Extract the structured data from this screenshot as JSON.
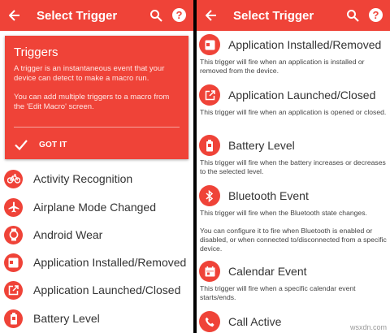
{
  "left": {
    "appbar": {
      "title": "Select Trigger"
    },
    "card": {
      "heading": "Triggers",
      "paragraph1": "A trigger is an instantaneous event that your device can detect to make a macro run.",
      "paragraph2": "You can add multiple triggers to a macro from the 'Edit Macro' screen.",
      "button": "GOT IT"
    },
    "items": [
      {
        "label": "Activity Recognition",
        "icon": "bicycle-icon"
      },
      {
        "label": "Airplane Mode Changed",
        "icon": "airplane-icon"
      },
      {
        "label": "Android Wear",
        "icon": "watch-icon"
      },
      {
        "label": "Application Installed/Removed",
        "icon": "app-install-icon"
      },
      {
        "label": "Application Launched/Closed",
        "icon": "launch-icon"
      },
      {
        "label": "Battery Level",
        "icon": "battery-icon"
      }
    ]
  },
  "right": {
    "appbar": {
      "title": "Select Trigger"
    },
    "items": [
      {
        "label": "Application Installed/Removed",
        "icon": "app-install-icon",
        "desc": [
          "This trigger will fire when an application is installed or removed from the device."
        ]
      },
      {
        "label": "Application Launched/Closed",
        "icon": "launch-icon",
        "desc": [
          "This trigger will fire when an application is opened or closed."
        ]
      },
      {
        "label": "Battery Level",
        "icon": "battery-icon",
        "desc": [
          "This trigger will fire when the battery increases or decreases to the selected level."
        ]
      },
      {
        "label": "Bluetooth Event",
        "icon": "bluetooth-icon",
        "desc": [
          "This trigger will fire when the Bluetooth state changes.",
          "You can configure it to fire when Bluetooth is enabled or disabled, or when connected to/disconnected from a specific device."
        ]
      },
      {
        "label": "Calendar Event",
        "icon": "calendar-icon",
        "desc": [
          "This trigger will fire when a specific calendar event starts/ends."
        ]
      },
      {
        "label": "Call Active",
        "icon": "phone-icon",
        "desc": []
      }
    ]
  },
  "watermark": "wsxdn.com",
  "colors": {
    "accent": "#ef4338"
  }
}
